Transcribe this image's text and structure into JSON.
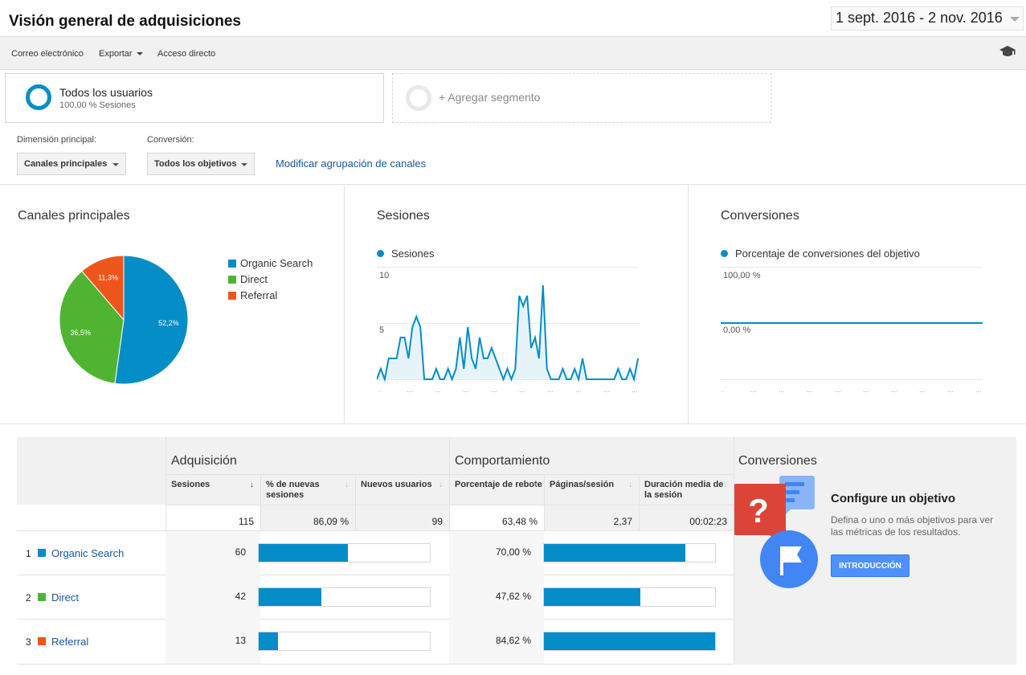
{
  "header": {
    "title": "Visión general de adquisiciones",
    "date_range": "1 sept. 2016 - 2 nov. 2016"
  },
  "toolbar": {
    "email_label": "Correo electrónico",
    "export_label": "Exportar",
    "shortcut_label": "Acceso directo",
    "academy_icon": "graduation-cap-icon"
  },
  "segments": {
    "active": {
      "name": "Todos los usuarios",
      "subtitle": "100,00 % Sesiones"
    },
    "add_label": "+ Agregar segmento"
  },
  "controls": {
    "primary_dimension_label": "Dimensión principal:",
    "primary_dimension_value": "Canales principales",
    "conversion_label": "Conversión:",
    "conversion_value": "Todos los objetivos",
    "modify_link": "Modificar agrupación de canales"
  },
  "charts": {
    "channels": {
      "title": "Canales principales",
      "chart_data": {
        "type": "pie",
        "categories": [
          "Organic Search",
          "Direct",
          "Referral"
        ],
        "values": [
          52.2,
          36.5,
          11.3
        ],
        "labels": [
          "52,2%",
          "36,5%",
          "11,3%"
        ],
        "colors": [
          "#058dc7",
          "#50b432",
          "#ed561b"
        ],
        "legend_position": "right"
      }
    },
    "sessions": {
      "title": "Sesiones",
      "chart_data": {
        "type": "area",
        "series": [
          {
            "name": "Sesiones",
            "color": "#058dc7",
            "values": [
              0,
              1,
              0,
              2,
              2,
              2,
              4,
              4,
              2,
              5,
              6,
              5,
              0,
              0,
              0,
              1,
              0,
              0,
              1,
              0,
              1,
              4,
              1,
              5,
              2,
              1,
              4,
              2,
              2,
              3,
              2,
              1,
              0,
              1,
              0,
              1,
              8,
              7,
              8,
              3,
              4,
              2,
              9,
              1,
              0,
              0,
              0,
              1,
              0,
              0,
              1,
              0,
              2,
              0,
              0,
              0,
              0,
              0,
              0,
              0,
              0,
              1,
              0,
              0,
              1,
              0,
              2
            ]
          }
        ],
        "y_ticks": [
          "10",
          "5"
        ],
        "ylim": [
          0,
          10
        ],
        "grid": true
      }
    },
    "conversions": {
      "title": "Conversiones",
      "chart_data": {
        "type": "line",
        "series": [
          {
            "name": "Porcentaje de conversiones del objetivo",
            "color": "#058dc7",
            "value": 0
          }
        ],
        "y_ticks": [
          "100,00 %",
          "0,00 %"
        ],
        "grid": true
      }
    }
  },
  "table": {
    "group_headers": {
      "acquisition": "Adquisición",
      "behavior": "Comportamiento",
      "conversions": "Conversiones"
    },
    "columns": {
      "sessions": "Sesiones",
      "pct_new": "% de nuevas sesiones",
      "new_users": "Nuevos usuarios",
      "bounce": "Porcentaje de rebote",
      "pages": "Páginas/sesión",
      "duration": "Duración media de la sesión"
    },
    "totals": {
      "sessions": "115",
      "pct_new": "86,09 %",
      "new_users": "99",
      "bounce": "63,48 %",
      "pages": "2,37",
      "duration": "00:02:23"
    },
    "rows": [
      {
        "rank": "1",
        "channel": "Organic Search",
        "color": "#058dc7",
        "sessions": "60",
        "sessions_fraction": 0.52,
        "bounce": "70,00 %",
        "bounce_fraction": 0.827
      },
      {
        "rank": "2",
        "channel": "Direct",
        "color": "#50b432",
        "sessions": "42",
        "sessions_fraction": 0.365,
        "bounce": "47,62 %",
        "bounce_fraction": 0.563
      },
      {
        "rank": "3",
        "channel": "Referral",
        "color": "#ed561b",
        "sessions": "13",
        "sessions_fraction": 0.113,
        "bounce": "84,62 %",
        "bounce_fraction": 1.0
      }
    ]
  },
  "goal_panel": {
    "title": "Configure un objetivo",
    "description": "Defina o uno o más objetivos para ver las métricas de los resultados.",
    "button": "INTRODUCCIÓN"
  }
}
